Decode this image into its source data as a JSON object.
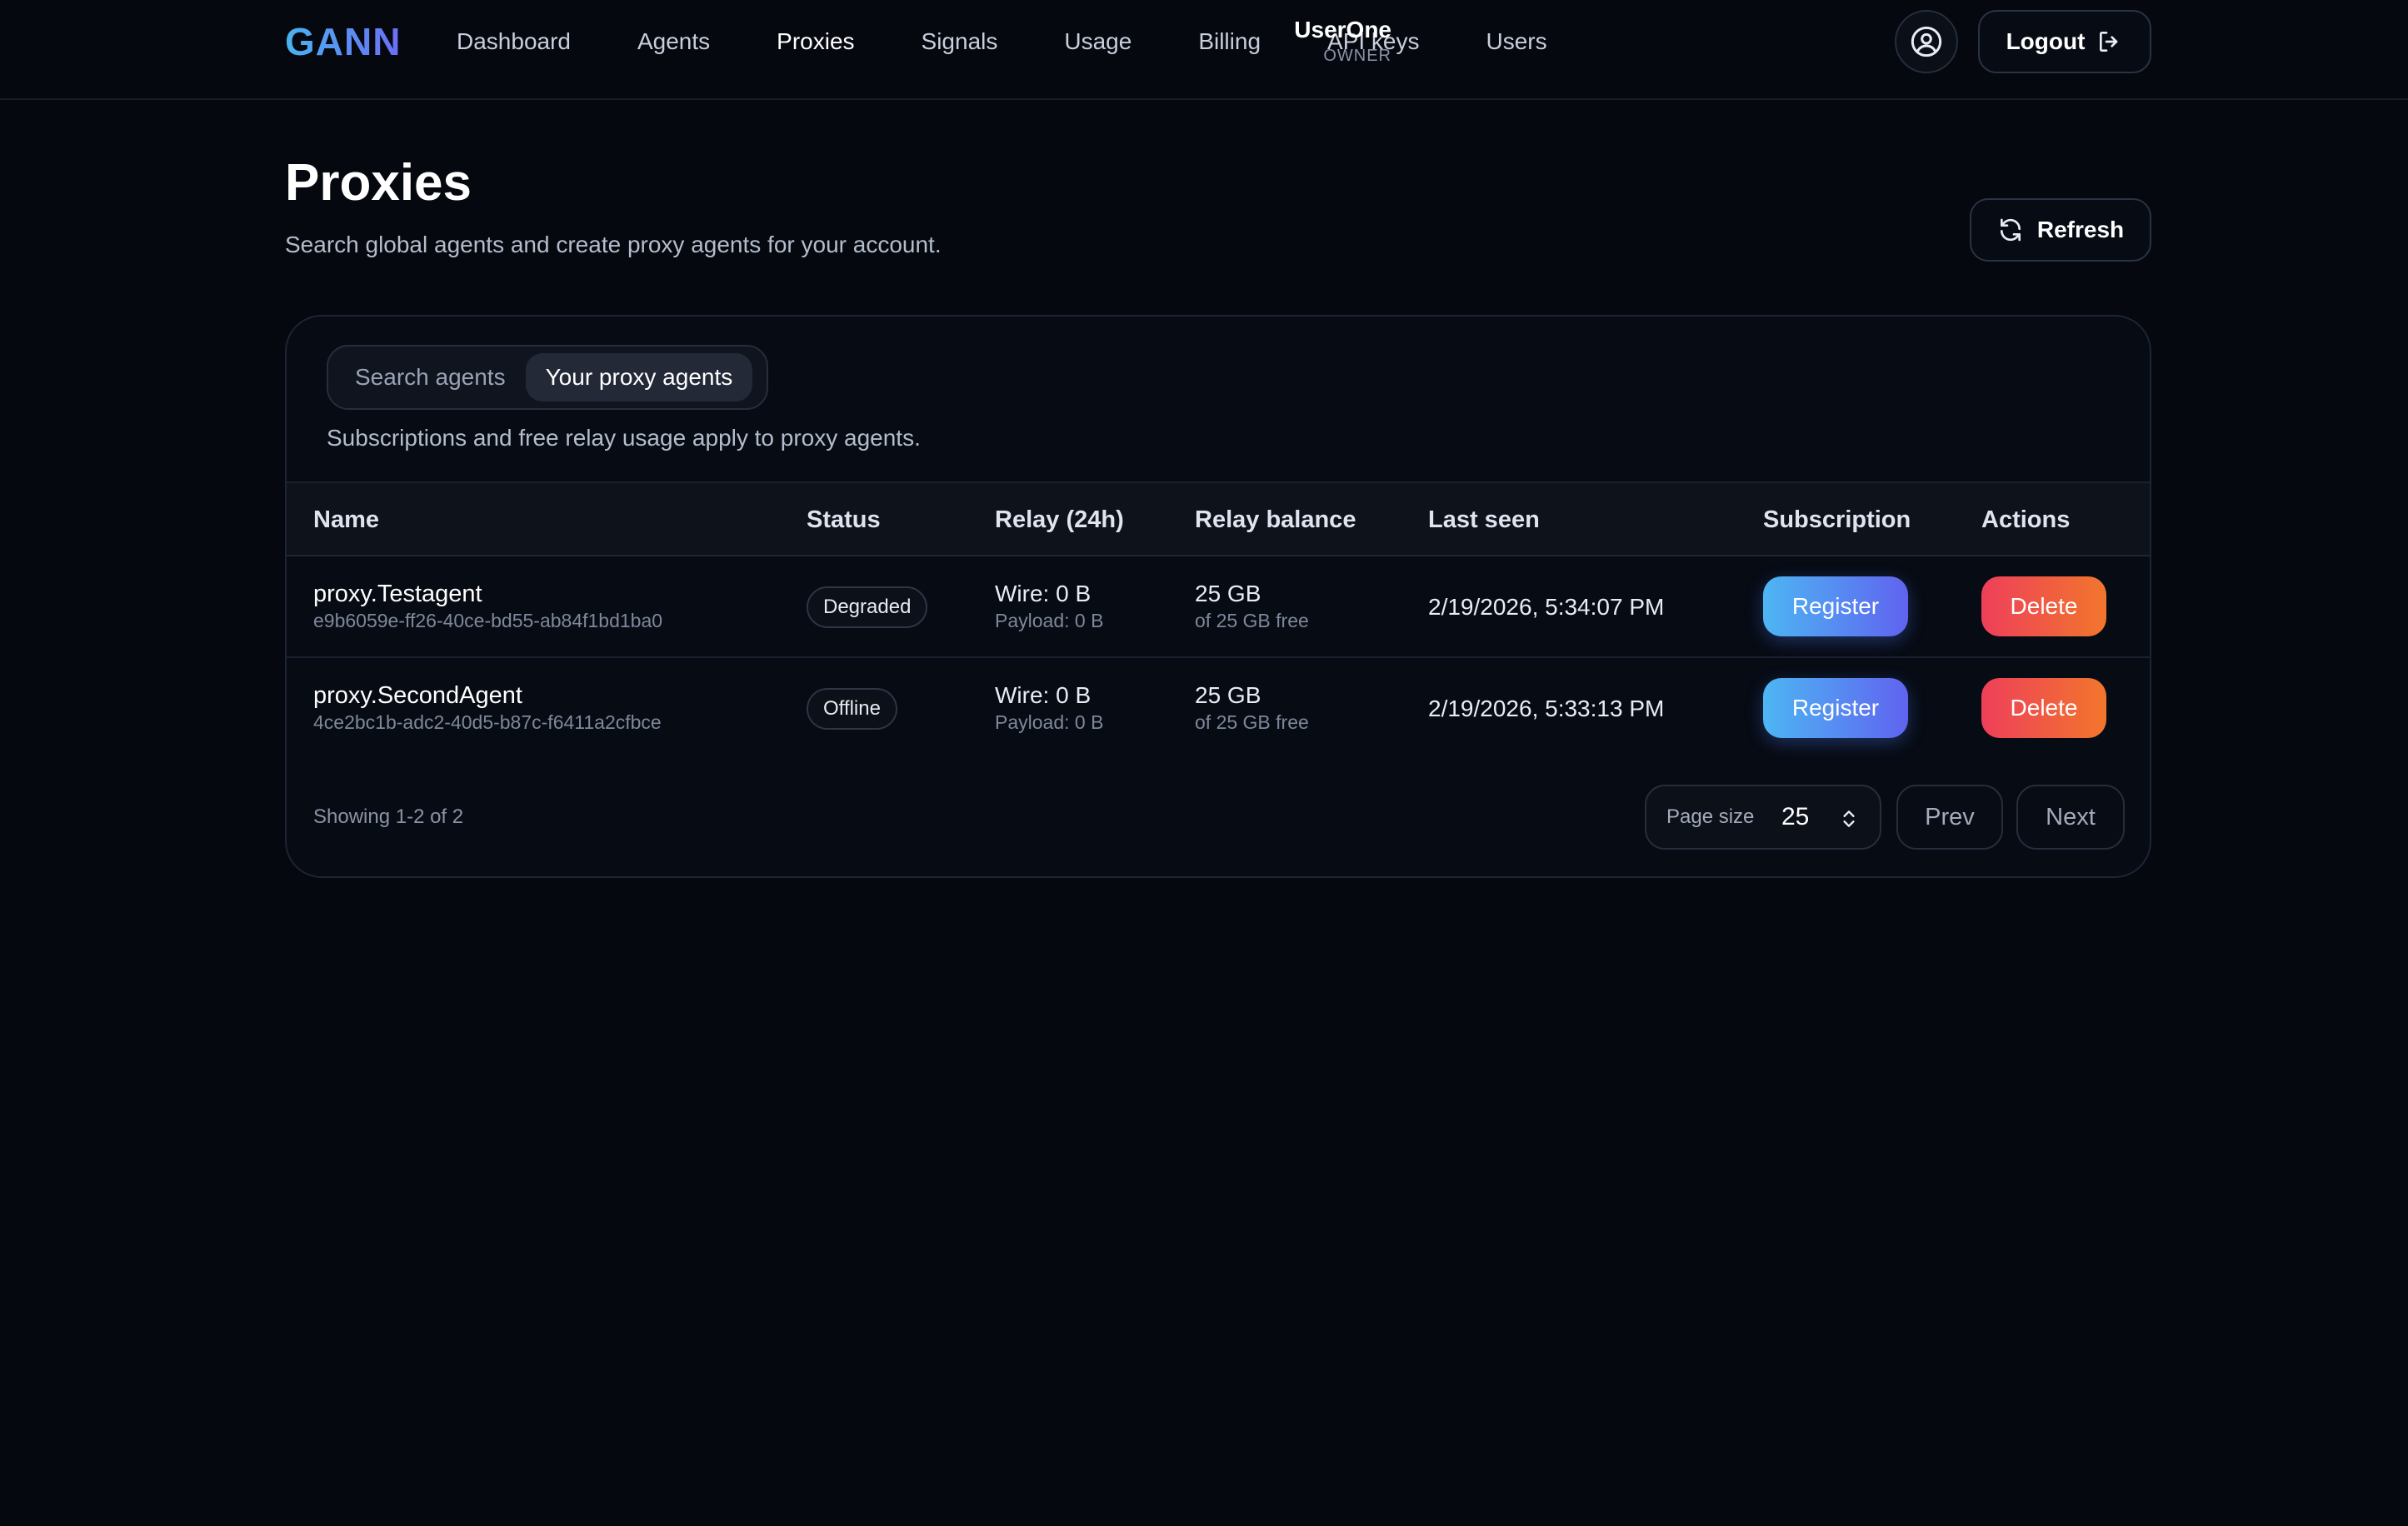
{
  "brand": "GANN",
  "nav": {
    "items": [
      {
        "label": "Dashboard"
      },
      {
        "label": "Agents"
      },
      {
        "label": "Proxies"
      },
      {
        "label": "Signals"
      },
      {
        "label": "Usage"
      },
      {
        "label": "Billing"
      },
      {
        "label": "API keys"
      },
      {
        "label": "Users"
      }
    ],
    "active": "Proxies"
  },
  "user": {
    "name": "UserOne",
    "role": "OWNER"
  },
  "logout_label": "Logout",
  "page": {
    "title": "Proxies",
    "subtitle": "Search global agents and create proxy agents for your account.",
    "refresh_label": "Refresh"
  },
  "card": {
    "tabs": [
      {
        "label": "Search agents"
      },
      {
        "label": "Your proxy agents"
      }
    ],
    "active_tab": "Your proxy agents",
    "note": "Subscriptions and free relay usage apply to proxy agents."
  },
  "table": {
    "columns": [
      "Name",
      "Status",
      "Relay (24h)",
      "Relay balance",
      "Last seen",
      "Subscription",
      "Actions"
    ],
    "rows": [
      {
        "name": "proxy.Testagent",
        "id": "e9b6059e-ff26-40ce-bd55-ab84f1bd1ba0",
        "status": "Degraded",
        "relay_wire": "Wire: 0 B",
        "relay_payload": "Payload: 0 B",
        "balance": "25 GB",
        "balance_note": "of 25 GB free",
        "last_seen": "2/19/2026, 5:34:07 PM",
        "subscription_action": "Register",
        "action": "Delete"
      },
      {
        "name": "proxy.SecondAgent",
        "id": "4ce2bc1b-adc2-40d5-b87c-f6411a2cfbce",
        "status": "Offline",
        "relay_wire": "Wire: 0 B",
        "relay_payload": "Payload: 0 B",
        "balance": "25 GB",
        "balance_note": "of 25 GB free",
        "last_seen": "2/19/2026, 5:33:13 PM",
        "subscription_action": "Register",
        "action": "Delete"
      }
    ]
  },
  "pagination": {
    "showing": "Showing 1-2 of 2",
    "page_size_label": "Page size",
    "page_size": "25",
    "prev_label": "Prev",
    "next_label": "Next"
  },
  "colors": {
    "background": "#05080f",
    "accent_gradient_start": "#4db6f3",
    "accent_gradient_end": "#6063f0",
    "danger_gradient_start": "#ee3f5a",
    "danger_gradient_end": "#f2762c"
  },
  "icons": {
    "avatar": "user-circle-icon",
    "logout": "logout-icon",
    "refresh": "refresh-icon",
    "page_size_caret": "chevron-up-down-icon"
  }
}
